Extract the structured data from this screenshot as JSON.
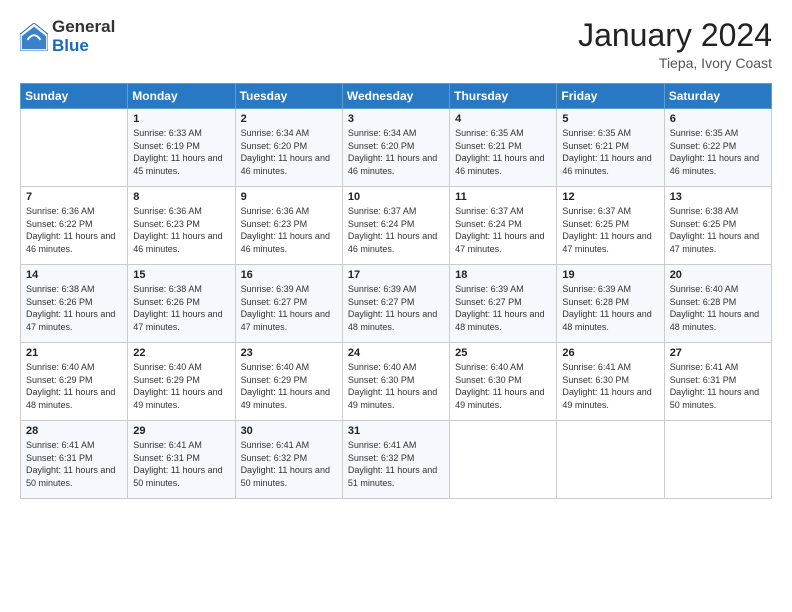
{
  "logo": {
    "general": "General",
    "blue": "Blue"
  },
  "header": {
    "month": "January 2024",
    "location": "Tiepa, Ivory Coast"
  },
  "weekdays": [
    "Sunday",
    "Monday",
    "Tuesday",
    "Wednesday",
    "Thursday",
    "Friday",
    "Saturday"
  ],
  "weeks": [
    [
      {
        "day": "",
        "sunrise": "",
        "sunset": "",
        "daylight": ""
      },
      {
        "day": "1",
        "sunrise": "Sunrise: 6:33 AM",
        "sunset": "Sunset: 6:19 PM",
        "daylight": "Daylight: 11 hours and 45 minutes."
      },
      {
        "day": "2",
        "sunrise": "Sunrise: 6:34 AM",
        "sunset": "Sunset: 6:20 PM",
        "daylight": "Daylight: 11 hours and 46 minutes."
      },
      {
        "day": "3",
        "sunrise": "Sunrise: 6:34 AM",
        "sunset": "Sunset: 6:20 PM",
        "daylight": "Daylight: 11 hours and 46 minutes."
      },
      {
        "day": "4",
        "sunrise": "Sunrise: 6:35 AM",
        "sunset": "Sunset: 6:21 PM",
        "daylight": "Daylight: 11 hours and 46 minutes."
      },
      {
        "day": "5",
        "sunrise": "Sunrise: 6:35 AM",
        "sunset": "Sunset: 6:21 PM",
        "daylight": "Daylight: 11 hours and 46 minutes."
      },
      {
        "day": "6",
        "sunrise": "Sunrise: 6:35 AM",
        "sunset": "Sunset: 6:22 PM",
        "daylight": "Daylight: 11 hours and 46 minutes."
      }
    ],
    [
      {
        "day": "7",
        "sunrise": "Sunrise: 6:36 AM",
        "sunset": "Sunset: 6:22 PM",
        "daylight": "Daylight: 11 hours and 46 minutes."
      },
      {
        "day": "8",
        "sunrise": "Sunrise: 6:36 AM",
        "sunset": "Sunset: 6:23 PM",
        "daylight": "Daylight: 11 hours and 46 minutes."
      },
      {
        "day": "9",
        "sunrise": "Sunrise: 6:36 AM",
        "sunset": "Sunset: 6:23 PM",
        "daylight": "Daylight: 11 hours and 46 minutes."
      },
      {
        "day": "10",
        "sunrise": "Sunrise: 6:37 AM",
        "sunset": "Sunset: 6:24 PM",
        "daylight": "Daylight: 11 hours and 46 minutes."
      },
      {
        "day": "11",
        "sunrise": "Sunrise: 6:37 AM",
        "sunset": "Sunset: 6:24 PM",
        "daylight": "Daylight: 11 hours and 47 minutes."
      },
      {
        "day": "12",
        "sunrise": "Sunrise: 6:37 AM",
        "sunset": "Sunset: 6:25 PM",
        "daylight": "Daylight: 11 hours and 47 minutes."
      },
      {
        "day": "13",
        "sunrise": "Sunrise: 6:38 AM",
        "sunset": "Sunset: 6:25 PM",
        "daylight": "Daylight: 11 hours and 47 minutes."
      }
    ],
    [
      {
        "day": "14",
        "sunrise": "Sunrise: 6:38 AM",
        "sunset": "Sunset: 6:26 PM",
        "daylight": "Daylight: 11 hours and 47 minutes."
      },
      {
        "day": "15",
        "sunrise": "Sunrise: 6:38 AM",
        "sunset": "Sunset: 6:26 PM",
        "daylight": "Daylight: 11 hours and 47 minutes."
      },
      {
        "day": "16",
        "sunrise": "Sunrise: 6:39 AM",
        "sunset": "Sunset: 6:27 PM",
        "daylight": "Daylight: 11 hours and 47 minutes."
      },
      {
        "day": "17",
        "sunrise": "Sunrise: 6:39 AM",
        "sunset": "Sunset: 6:27 PM",
        "daylight": "Daylight: 11 hours and 48 minutes."
      },
      {
        "day": "18",
        "sunrise": "Sunrise: 6:39 AM",
        "sunset": "Sunset: 6:27 PM",
        "daylight": "Daylight: 11 hours and 48 minutes."
      },
      {
        "day": "19",
        "sunrise": "Sunrise: 6:39 AM",
        "sunset": "Sunset: 6:28 PM",
        "daylight": "Daylight: 11 hours and 48 minutes."
      },
      {
        "day": "20",
        "sunrise": "Sunrise: 6:40 AM",
        "sunset": "Sunset: 6:28 PM",
        "daylight": "Daylight: 11 hours and 48 minutes."
      }
    ],
    [
      {
        "day": "21",
        "sunrise": "Sunrise: 6:40 AM",
        "sunset": "Sunset: 6:29 PM",
        "daylight": "Daylight: 11 hours and 48 minutes."
      },
      {
        "day": "22",
        "sunrise": "Sunrise: 6:40 AM",
        "sunset": "Sunset: 6:29 PM",
        "daylight": "Daylight: 11 hours and 49 minutes."
      },
      {
        "day": "23",
        "sunrise": "Sunrise: 6:40 AM",
        "sunset": "Sunset: 6:29 PM",
        "daylight": "Daylight: 11 hours and 49 minutes."
      },
      {
        "day": "24",
        "sunrise": "Sunrise: 6:40 AM",
        "sunset": "Sunset: 6:30 PM",
        "daylight": "Daylight: 11 hours and 49 minutes."
      },
      {
        "day": "25",
        "sunrise": "Sunrise: 6:40 AM",
        "sunset": "Sunset: 6:30 PM",
        "daylight": "Daylight: 11 hours and 49 minutes."
      },
      {
        "day": "26",
        "sunrise": "Sunrise: 6:41 AM",
        "sunset": "Sunset: 6:30 PM",
        "daylight": "Daylight: 11 hours and 49 minutes."
      },
      {
        "day": "27",
        "sunrise": "Sunrise: 6:41 AM",
        "sunset": "Sunset: 6:31 PM",
        "daylight": "Daylight: 11 hours and 50 minutes."
      }
    ],
    [
      {
        "day": "28",
        "sunrise": "Sunrise: 6:41 AM",
        "sunset": "Sunset: 6:31 PM",
        "daylight": "Daylight: 11 hours and 50 minutes."
      },
      {
        "day": "29",
        "sunrise": "Sunrise: 6:41 AM",
        "sunset": "Sunset: 6:31 PM",
        "daylight": "Daylight: 11 hours and 50 minutes."
      },
      {
        "day": "30",
        "sunrise": "Sunrise: 6:41 AM",
        "sunset": "Sunset: 6:32 PM",
        "daylight": "Daylight: 11 hours and 50 minutes."
      },
      {
        "day": "31",
        "sunrise": "Sunrise: 6:41 AM",
        "sunset": "Sunset: 6:32 PM",
        "daylight": "Daylight: 11 hours and 51 minutes."
      },
      {
        "day": "",
        "sunrise": "",
        "sunset": "",
        "daylight": ""
      },
      {
        "day": "",
        "sunrise": "",
        "sunset": "",
        "daylight": ""
      },
      {
        "day": "",
        "sunrise": "",
        "sunset": "",
        "daylight": ""
      }
    ]
  ]
}
